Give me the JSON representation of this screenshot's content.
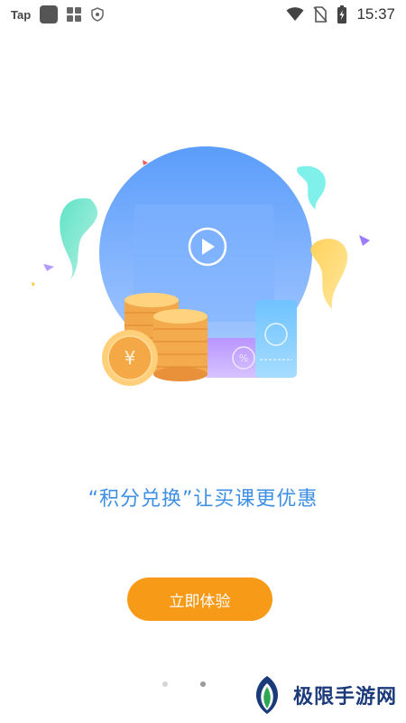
{
  "status_bar": {
    "app_label": "Tap",
    "time": "15:37",
    "icons": [
      "app-square-icon",
      "grid-apps-icon",
      "shield-icon",
      "wifi-icon",
      "no-sim-icon",
      "battery-icon"
    ]
  },
  "onboarding": {
    "headline": "“积分兑换”让买课更优惠",
    "cta_label": "立即体验",
    "page_indicator": {
      "total": 2,
      "current": 2
    }
  },
  "watermark": {
    "text": "极限手游网"
  },
  "colors": {
    "accent_blue": "#3d8fe6",
    "cta_orange": "#f79a17",
    "dot_inactive": "#d6d6d6",
    "dot_active": "#9a9a9a"
  }
}
